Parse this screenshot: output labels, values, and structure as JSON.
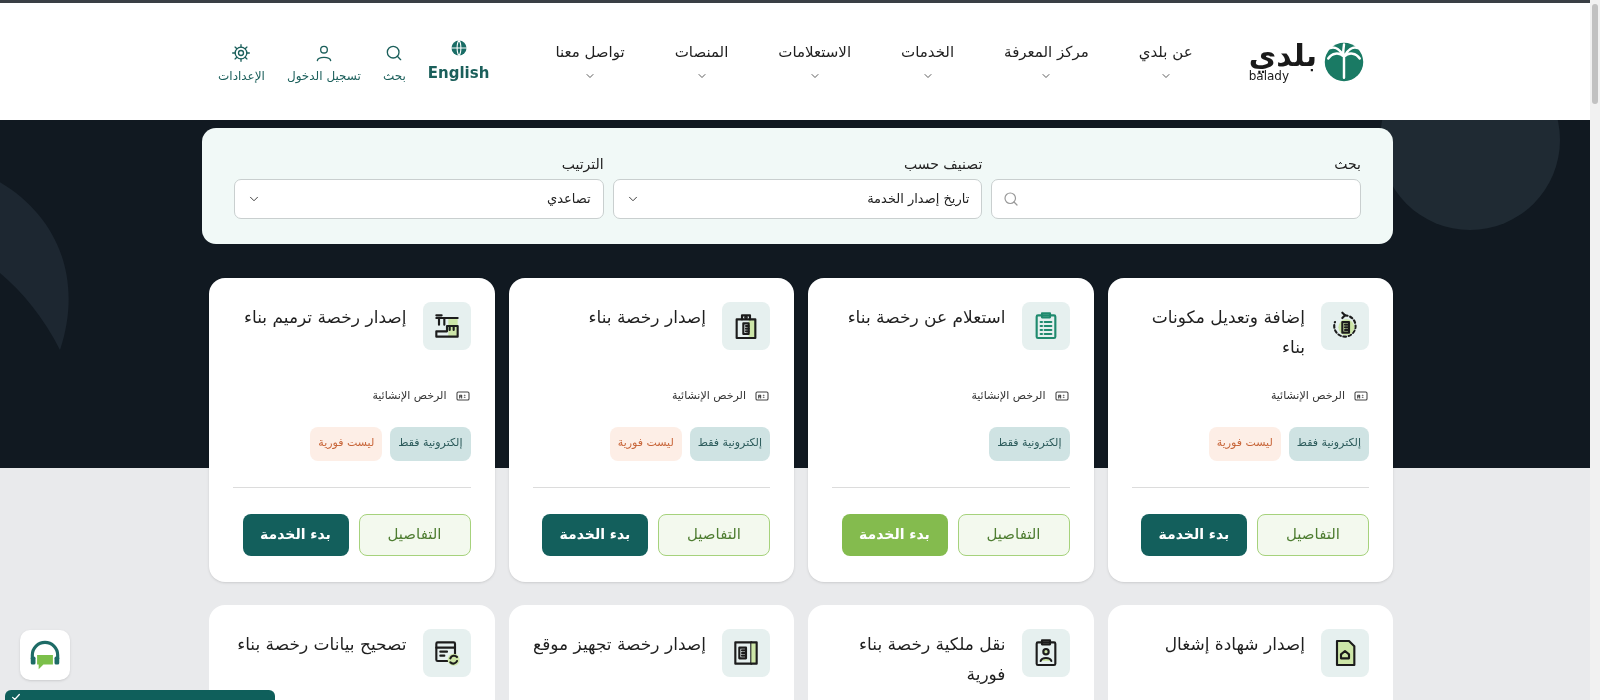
{
  "header": {
    "logo": {
      "arabic": "بلدي",
      "latin": "balady"
    },
    "nav": [
      {
        "label": "عن بلدي"
      },
      {
        "label": "مركز المعرفة"
      },
      {
        "label": "الخدمات"
      },
      {
        "label": "الاستعلامات"
      },
      {
        "label": "المنصات"
      },
      {
        "label": "تواصل معنا"
      }
    ],
    "utilities": [
      {
        "label": "English"
      },
      {
        "label": "بحث"
      },
      {
        "label": "تسجيل الدخول"
      },
      {
        "label": "الإعدادات"
      }
    ]
  },
  "filters": {
    "search": {
      "label": "بحث"
    },
    "classify": {
      "label": "تصنيف حسب",
      "value": "تاريخ إصدار الخدمة"
    },
    "sort": {
      "label": "الترتيب",
      "value": "تصاعدي"
    }
  },
  "services": [
    {
      "title": "إضافة وتعديل مكونات بناء",
      "category": "الرخص الإنشائية",
      "badges": [
        {
          "kind": "channel",
          "label": "إلكترونية فقط"
        },
        {
          "kind": "timing",
          "label": "ليست فورية"
        }
      ],
      "details_button": "التفاصيل",
      "start_button": {
        "label": "بدء الخدمة",
        "highlighted": false
      }
    },
    {
      "title": "استعلام عن رخصة بناء",
      "category": "الرخص الإنشائية",
      "badges": [
        {
          "kind": "channel",
          "label": "إلكترونية فقط"
        }
      ],
      "details_button": "التفاصيل",
      "start_button": {
        "label": "بدء الخدمة",
        "highlighted": true
      }
    },
    {
      "title": "إصدار رخصة بناء",
      "category": "الرخص الإنشائية",
      "badges": [
        {
          "kind": "channel",
          "label": "إلكترونية فقط"
        },
        {
          "kind": "timing",
          "label": "ليست فورية"
        }
      ],
      "details_button": "التفاصيل",
      "start_button": {
        "label": "بدء الخدمة",
        "highlighted": false
      }
    },
    {
      "title": "إصدار رخصة ترميم بناء",
      "category": "الرخص الإنشائية",
      "badges": [
        {
          "kind": "channel",
          "label": "إلكترونية فقط"
        },
        {
          "kind": "timing",
          "label": "ليست فورية"
        }
      ],
      "details_button": "التفاصيل",
      "start_button": {
        "label": "بدء الخدمة",
        "highlighted": false
      }
    }
  ],
  "more_services": [
    {
      "title": "إصدار شهادة إشغال"
    },
    {
      "title": "نقل ملكية رخصة بناء فورية"
    },
    {
      "title": "إصدار رخصة تجهيز موقع"
    },
    {
      "title": "تصحيح بيانات رخصة بناء"
    }
  ]
}
